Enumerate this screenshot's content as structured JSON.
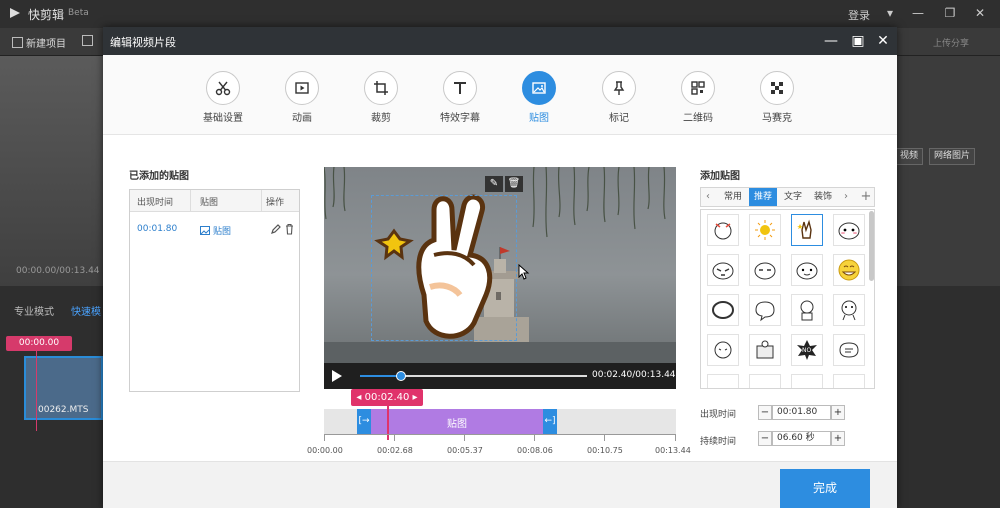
{
  "app": {
    "title": "快剪辑",
    "beta": "Beta",
    "login": "登录",
    "toolbar": {
      "new_project": "新建项目",
      "upload_share": "上传分享"
    },
    "right_buttons": {
      "video": "视频",
      "web_image": "网络图片"
    },
    "preview_time": "00:00.00/00:13.44",
    "mode_pro": "专业模式",
    "mode_fast": "快速模",
    "timeline_marker": "00:00.00",
    "clip_name": "00262.MTS"
  },
  "dialog": {
    "title": "编辑视频片段",
    "tabs": [
      {
        "label": "基础设置",
        "icon": "scissors-icon"
      },
      {
        "label": "动画",
        "icon": "play-frame-icon"
      },
      {
        "label": "裁剪",
        "icon": "crop-icon"
      },
      {
        "label": "特效字幕",
        "icon": "text-icon"
      },
      {
        "label": "贴图",
        "icon": "image-icon"
      },
      {
        "label": "标记",
        "icon": "pin-icon"
      },
      {
        "label": "二维码",
        "icon": "qrcode-icon"
      },
      {
        "label": "马赛克",
        "icon": "mosaic-icon"
      }
    ],
    "added_title": "已添加的贴图",
    "list_headers": [
      "出现时间",
      "贴图",
      "操作"
    ],
    "list_rows": [
      {
        "time": "00:01.80",
        "sticker": "贴图"
      }
    ],
    "player": {
      "time": "00:02.40/00:13.44",
      "progress": 0.179
    },
    "timeline": {
      "marker": "00:02.40",
      "segment_label": "贴图",
      "ruler": [
        "00:00.00",
        "00:02.68",
        "00:05.37",
        "00:08.06",
        "00:10.75",
        "00:13.44"
      ]
    },
    "add_title": "添加贴图",
    "sticker_tabs": [
      "常用",
      "推荐",
      "文字",
      "装饰"
    ],
    "sticker_tab_active": 1,
    "appear_label": "出现时间",
    "appear_value": "00:01.80",
    "duration_label": "持续时间",
    "duration_value": "06.60 秒",
    "done": "完成",
    "colors": {
      "accent": "#2d8de0",
      "marker": "#e0336b",
      "segment": "#b07be3"
    }
  }
}
